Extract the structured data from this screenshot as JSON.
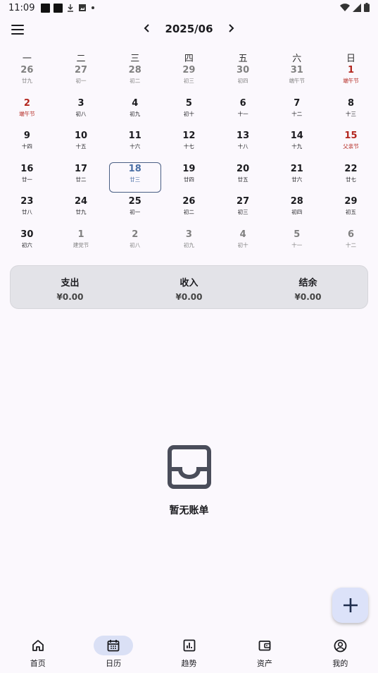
{
  "status": {
    "time": "11:09"
  },
  "header": {
    "month": "2025/06"
  },
  "weekdays": [
    "一",
    "二",
    "三",
    "四",
    "五",
    "六",
    "日"
  ],
  "weeks": [
    [
      {
        "d": "26",
        "l": "廿九",
        "t": "other"
      },
      {
        "d": "27",
        "l": "初一",
        "t": "other"
      },
      {
        "d": "28",
        "l": "初二",
        "t": "other"
      },
      {
        "d": "29",
        "l": "初三",
        "t": "other"
      },
      {
        "d": "30",
        "l": "初四",
        "t": "other"
      },
      {
        "d": "31",
        "l": "端午节",
        "t": "other"
      },
      {
        "d": "1",
        "l": "端午节",
        "t": "holiday"
      }
    ],
    [
      {
        "d": "2",
        "l": "端午节",
        "t": "holiday"
      },
      {
        "d": "3",
        "l": "初八",
        "t": ""
      },
      {
        "d": "4",
        "l": "初九",
        "t": ""
      },
      {
        "d": "5",
        "l": "初十",
        "t": ""
      },
      {
        "d": "6",
        "l": "十一",
        "t": ""
      },
      {
        "d": "7",
        "l": "十二",
        "t": ""
      },
      {
        "d": "8",
        "l": "十三",
        "t": ""
      }
    ],
    [
      {
        "d": "9",
        "l": "十四",
        "t": ""
      },
      {
        "d": "10",
        "l": "十五",
        "t": ""
      },
      {
        "d": "11",
        "l": "十六",
        "t": ""
      },
      {
        "d": "12",
        "l": "十七",
        "t": ""
      },
      {
        "d": "13",
        "l": "十八",
        "t": ""
      },
      {
        "d": "14",
        "l": "十九",
        "t": ""
      },
      {
        "d": "15",
        "l": "父亲节",
        "t": "holiday"
      }
    ],
    [
      {
        "d": "16",
        "l": "廿一",
        "t": ""
      },
      {
        "d": "17",
        "l": "廿二",
        "t": ""
      },
      {
        "d": "18",
        "l": "廿三",
        "t": "today"
      },
      {
        "d": "19",
        "l": "廿四",
        "t": ""
      },
      {
        "d": "20",
        "l": "廿五",
        "t": ""
      },
      {
        "d": "21",
        "l": "廿六",
        "t": ""
      },
      {
        "d": "22",
        "l": "廿七",
        "t": ""
      }
    ],
    [
      {
        "d": "23",
        "l": "廿八",
        "t": ""
      },
      {
        "d": "24",
        "l": "廿九",
        "t": ""
      },
      {
        "d": "25",
        "l": "初一",
        "t": ""
      },
      {
        "d": "26",
        "l": "初二",
        "t": ""
      },
      {
        "d": "27",
        "l": "初三",
        "t": ""
      },
      {
        "d": "28",
        "l": "初四",
        "t": ""
      },
      {
        "d": "29",
        "l": "初五",
        "t": ""
      }
    ],
    [
      {
        "d": "30",
        "l": "初六",
        "t": ""
      },
      {
        "d": "1",
        "l": "建党节",
        "t": "other"
      },
      {
        "d": "2",
        "l": "初八",
        "t": "other"
      },
      {
        "d": "3",
        "l": "初九",
        "t": "other"
      },
      {
        "d": "4",
        "l": "初十",
        "t": "other"
      },
      {
        "d": "5",
        "l": "十一",
        "t": "other"
      },
      {
        "d": "6",
        "l": "十二",
        "t": "other"
      }
    ]
  ],
  "summary": {
    "expense_label": "支出",
    "expense_value": "¥0.00",
    "income_label": "收入",
    "income_value": "¥0.00",
    "balance_label": "结余",
    "balance_value": "¥0.00"
  },
  "empty": {
    "text": "暂无账单",
    "icon": "inbox-icon"
  },
  "fab": {
    "icon": "plus-icon"
  },
  "nav": [
    {
      "label": "首页",
      "icon": "home-icon",
      "active": false
    },
    {
      "label": "日历",
      "icon": "calendar-icon",
      "active": true
    },
    {
      "label": "趋势",
      "icon": "chart-icon",
      "active": false
    },
    {
      "label": "资产",
      "icon": "wallet-icon",
      "active": false
    },
    {
      "label": "我的",
      "icon": "account-icon",
      "active": false
    }
  ],
  "colors": {
    "holiday": "#b3261e",
    "today": "#4a6fa5",
    "accent": "#dae0f5",
    "fab": "#dce2f9"
  }
}
